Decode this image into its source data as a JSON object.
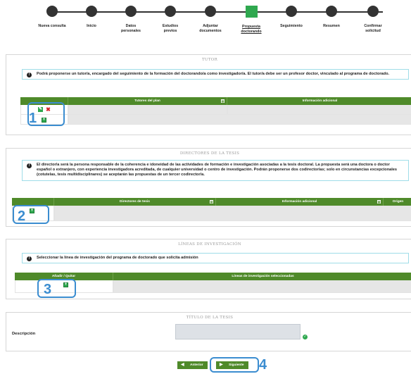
{
  "stepper": {
    "steps": [
      {
        "label": "Nueva consulta",
        "active": false
      },
      {
        "label": "Inicio",
        "active": false
      },
      {
        "label": "Datos personales",
        "active": false
      },
      {
        "label": "Estudios previos",
        "active": false
      },
      {
        "label": "Adjuntar documentos",
        "active": false
      },
      {
        "label": "Propuesta doctorando",
        "active": true
      },
      {
        "label": "Seguimiento",
        "active": false
      },
      {
        "label": "Resumen",
        "active": false
      },
      {
        "label": "Confirmar solicitud",
        "active": false
      }
    ]
  },
  "tutor": {
    "legend": "TUTOR",
    "info": "Podrá proponerse un tutor/a, encargado del seguimiento de la formación del doctorando/a como investigador/a. El tutor/a debe ser un profesor doctor, vinculado al programa de doctorado.",
    "columns": [
      "Tutores del plan",
      "Información adicional"
    ],
    "callout": "1"
  },
  "directores": {
    "legend": "DIRECTORES DE LA TESIS",
    "info": "El director/a será la persona responsable de la coherencia e idoneidad de las actividades de formación e investigación asociadas a la tesis doctoral. La propuesta será una doctora o doctor español o extranjero, con experiencia investigadora acreditada, de cualquier universidad o centro de investigación. Podrán proponerse dos codirector/as; solo en circunstancias excepcionales (cotutelas, tesis multidisciplinares) se aceptarán las propuestas de un tercer codirector/a.",
    "columns": [
      "Directores de tesis",
      "Información adicional",
      "Origen"
    ],
    "callout": "2"
  },
  "lineas": {
    "legend": "LÍNEAS DE INVESTIGACIÓN",
    "info": "Seleccionar la línea de investigación del programa de doctorado que solicita admisión",
    "columns": [
      "Añadir / Quitar",
      "Líneas de investigación seleccionadas"
    ],
    "callout": "3"
  },
  "titulo": {
    "legend": "TÍTULO DE LA TESIS",
    "description_label": "Descripción",
    "description_value": ""
  },
  "footer": {
    "prev_label": "Anterior",
    "next_label": "Siguiente",
    "callout": "4"
  },
  "colors": {
    "accent_green": "#4f8a2a",
    "step_active": "#2fa84f",
    "callout_blue": "#3b8dd0",
    "info_border": "#9fdde8"
  }
}
